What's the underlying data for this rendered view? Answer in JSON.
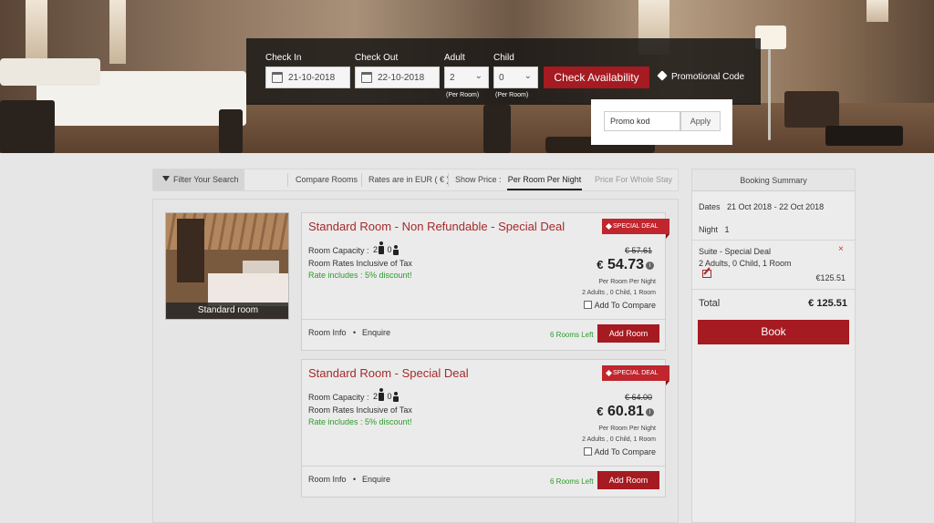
{
  "search": {
    "check_in_label": "Check In",
    "check_in_value": "21-10-2018",
    "check_out_label": "Check Out",
    "check_out_value": "22-10-2018",
    "adult_label": "Adult",
    "adult_value": "2",
    "adult_sub": "(Per Room)",
    "child_label": "Child",
    "child_value": "0",
    "child_sub": "(Per Room)",
    "check_button": "Check Availability",
    "promo_link": "Promotional Code",
    "promo_input": "Promo kod",
    "promo_apply": "Apply"
  },
  "tabs": {
    "filter": "Filter Your Search",
    "compare": "Compare Rooms",
    "rates": "Rates are in EUR ( € )",
    "show_price": "Show Price :",
    "per_room": "Per Room Per Night",
    "whole_stay": "Price For Whole Stay"
  },
  "room_image_caption": "Standard room",
  "rooms": [
    {
      "title": "Standard Room - Non Refundable - Special Deal",
      "ribbon": "SPECIAL DEAL",
      "capacity_label": "Room Capacity :",
      "adults": "2",
      "children": "0",
      "tax_note": "Room Rates Inclusive of Tax",
      "discount": "Rate includes : 5% discount!",
      "old_price": "€ 57.61",
      "currency": "€",
      "price": "54.73",
      "per": "Per Room Per Night",
      "occupancy": "2 Adults , 0 Child, 1 Room",
      "compare": "Add To Compare",
      "info": "Room Info",
      "enquire": "Enquire",
      "rooms_left": "6 Rooms Left",
      "add": "Add Room"
    },
    {
      "title": "Standard Room - Special Deal",
      "ribbon": "SPECIAL DEAL",
      "capacity_label": "Room Capacity :",
      "adults": "2",
      "children": "0",
      "tax_note": "Room Rates Inclusive of Tax",
      "discount": "Rate includes : 5% discount!",
      "old_price": "€ 64.00",
      "currency": "€",
      "price": "60.81",
      "per": "Per Room Per Night",
      "occupancy": "2 Adults , 0 Child, 1 Room",
      "compare": "Add To Compare",
      "info": "Room Info",
      "enquire": "Enquire",
      "rooms_left": "6 Rooms Left",
      "add": "Add Room"
    }
  ],
  "summary": {
    "header": "Booking Summary",
    "dates_label": "Dates",
    "dates_value": "21 Oct 2018 - 22 Oct 2018",
    "night_label": "Night",
    "night_value": "1",
    "item_name": "Suite - Special Deal",
    "item_details": "2 Adults, 0 Child, 1 Room",
    "item_amount": "€125.51",
    "remove": "×",
    "total_label": "Total",
    "total_value": "€ 125.51",
    "book": "Book"
  },
  "colors": {
    "accent": "#a61a21",
    "title": "#a52a2a",
    "green": "#2e9a2e"
  }
}
